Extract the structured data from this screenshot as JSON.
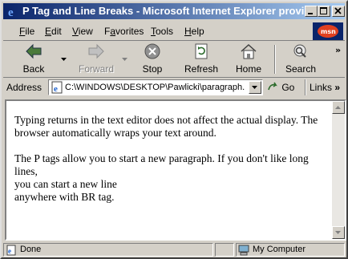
{
  "window": {
    "title": "P Tag and Line Breaks - Microsoft Internet Explorer provide...",
    "controls": [
      "_",
      "□",
      "×"
    ]
  },
  "menu": {
    "items": [
      {
        "u": "F",
        "rest": "ile"
      },
      {
        "u": "E",
        "rest": "dit"
      },
      {
        "u": "V",
        "rest": "iew"
      },
      {
        "pre": "F",
        "u": "a",
        "rest": "vorites"
      },
      {
        "u": "T",
        "rest": "ools"
      },
      {
        "u": "H",
        "rest": "elp"
      }
    ],
    "brand": "msn"
  },
  "toolbar": {
    "back": "Back",
    "forward": "Forward",
    "stop": "Stop",
    "refresh": "Refresh",
    "home": "Home",
    "search": "Search",
    "more": "»"
  },
  "address": {
    "label": "Address",
    "value": "C:\\WINDOWS\\DESKTOP\\Pawlicki\\paragraph.",
    "go": "Go",
    "links": "Links",
    "more": "»"
  },
  "page": {
    "para1": "Typing returns in the text editor does not affect the actual display. The browser automatically wraps your text around.",
    "para2_line1": "The P tags allow you to start a new paragraph. If you don't like long lines,",
    "para2_line2": "you can start a new line",
    "para2_line3": "anywhere with BR tag."
  },
  "status": {
    "text": "Done",
    "zone": "My Computer"
  }
}
